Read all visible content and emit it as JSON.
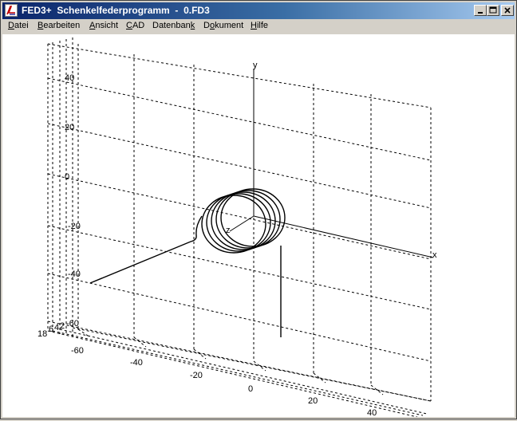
{
  "window": {
    "title": "FED3+  Schenkelfederprogramm  -  0.FD3",
    "controls": {
      "minimize": "minimize",
      "maximize": "maximize",
      "close": "close"
    }
  },
  "menu": [
    {
      "label": "Datei",
      "mnemonic": "D",
      "rest": "atei"
    },
    {
      "label": "Bearbeiten",
      "mnemonic": "B",
      "rest": "earbeiten"
    },
    {
      "label": "Ansicht",
      "mnemonic": "A",
      "rest": "nsicht"
    },
    {
      "label": "CAD",
      "mnemonic": "C",
      "rest": "AD"
    },
    {
      "label": "Datenbank",
      "pre": "Datenban",
      "mnemonic": "k",
      "rest": ""
    },
    {
      "label": "Dokument",
      "pre": "D",
      "mnemonic": "o",
      "rest": "kument"
    },
    {
      "label": "Hilfe",
      "mnemonic": "H",
      "rest": "ilfe"
    }
  ],
  "plot": {
    "axes": {
      "x": "x",
      "y": "y",
      "z": "z"
    },
    "y_ticks": [
      "40",
      "20",
      "0",
      "-20",
      "-40",
      "-60"
    ],
    "x_ticks": [
      "-60",
      "-40",
      "-20",
      "0",
      "20",
      "40"
    ],
    "depth_ticks": [
      "18",
      "6",
      "4",
      "2"
    ]
  }
}
